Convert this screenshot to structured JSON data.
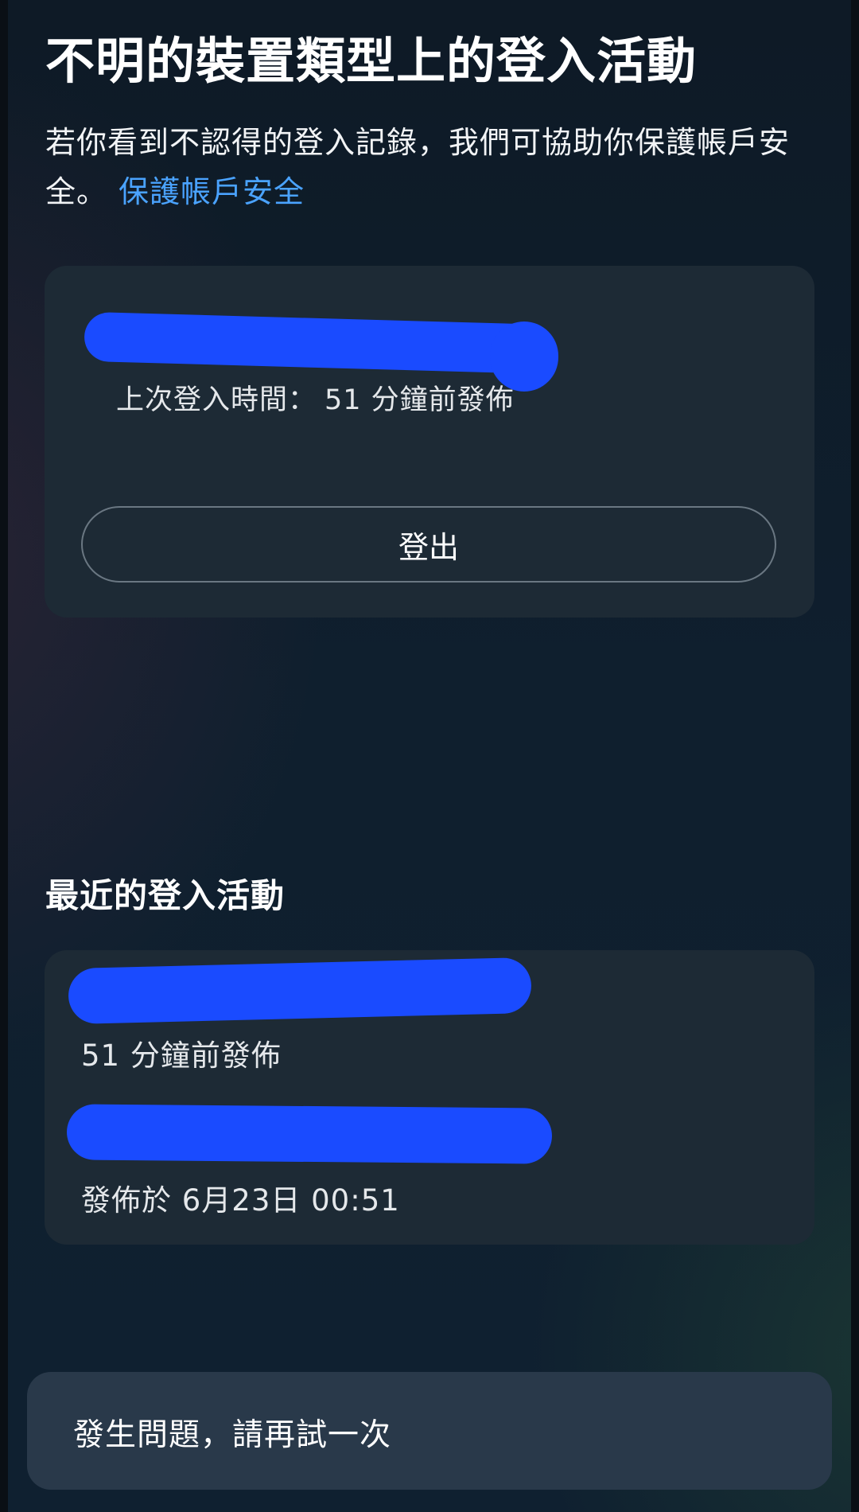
{
  "page": {
    "title": "不明的裝置類型上的登入活動",
    "description": "若你看到不認得的登入記錄，我們可協助你保護帳戶安全。",
    "secure_link": "保護帳戶安全"
  },
  "current_device": {
    "last_login_label": "上次登入時間：",
    "last_login_value": "51 分鐘前發佈",
    "logout_label": "登出"
  },
  "recent": {
    "heading": "最近的登入活動",
    "items": [
      {
        "time": "51 分鐘前發佈"
      },
      {
        "time": "發佈於 6月23日 00:51"
      }
    ]
  },
  "toast": {
    "message": "發生問題，請再試一次"
  },
  "colors": {
    "background": "#0f1d2a",
    "card": "#1d2a35",
    "link": "#4aa3ff",
    "redaction": "#1a4bff",
    "toast": "#29394a"
  }
}
